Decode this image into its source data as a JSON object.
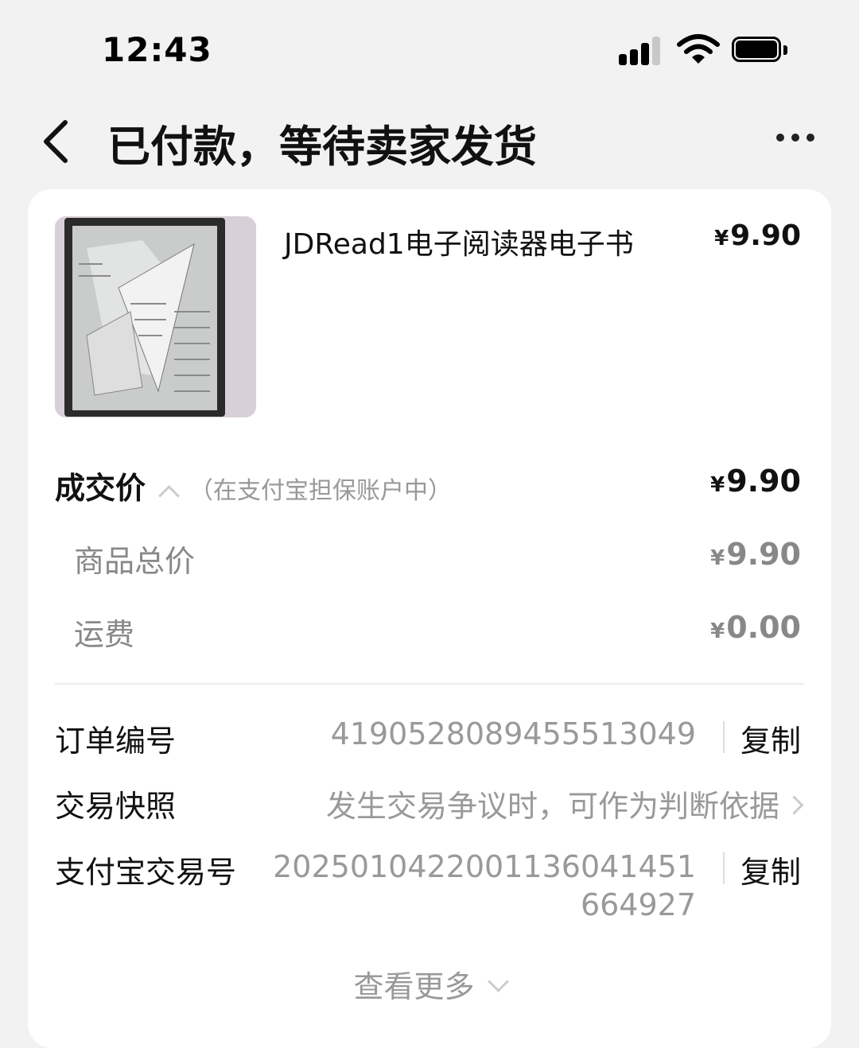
{
  "status_bar": {
    "time": "12:43"
  },
  "nav": {
    "title": "已付款，等待卖家发货"
  },
  "product": {
    "name": "JDRead1电子阅读器电子书",
    "currency": "¥",
    "price": "9.90"
  },
  "deal": {
    "label": "成交价",
    "note": "（在支付宝担保账户中）",
    "currency": "¥",
    "price": "9.90"
  },
  "breakdown": [
    {
      "label": "商品总价",
      "currency": "¥",
      "amount": "9.90"
    },
    {
      "label": "运费",
      "currency": "¥",
      "amount": "0.00"
    }
  ],
  "info": {
    "order_no_label": "订单编号",
    "order_no_value": "4190528089455513049",
    "copy_label": "复制",
    "snapshot_label": "交易快照",
    "snapshot_value": "发生交易争议时，可作为判断依据",
    "alipay_no_label": "支付宝交易号",
    "alipay_no_line1": "2025010422001136041451",
    "alipay_no_line2": "664927"
  },
  "view_more": "查看更多",
  "colors": {
    "background": "#f2f2f2",
    "card": "#ffffff",
    "muted_text": "#999999"
  }
}
